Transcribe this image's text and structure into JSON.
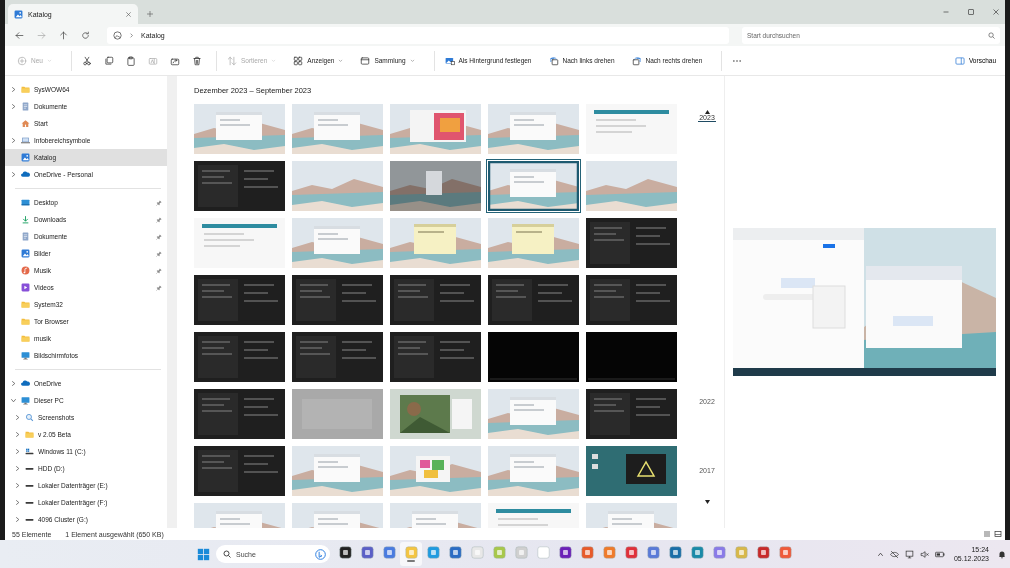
{
  "window": {
    "tab": {
      "title": "Katalog"
    },
    "breadcrumb": [
      {
        "label": "Katalog"
      }
    ],
    "search": {
      "placeholder": "Start durchsuchen"
    }
  },
  "toolbar": [
    {
      "kind": "new",
      "label": "Neu",
      "dropdown": true,
      "disabled": true
    },
    {
      "kind": "separator"
    },
    {
      "kind": "cut",
      "disabled": false
    },
    {
      "kind": "copy",
      "disabled": false
    },
    {
      "kind": "paste",
      "disabled": false
    },
    {
      "kind": "rename",
      "disabled": true
    },
    {
      "kind": "share",
      "disabled": false
    },
    {
      "kind": "delete",
      "disabled": false
    },
    {
      "kind": "separator"
    },
    {
      "kind": "sort",
      "label": "Sortieren",
      "dropdown": true,
      "disabled": true
    },
    {
      "kind": "view",
      "label": "Anzeigen",
      "dropdown": true,
      "disabled": false
    },
    {
      "kind": "collection",
      "label": "Sammlung",
      "dropdown": true,
      "disabled": false
    },
    {
      "kind": "separator"
    },
    {
      "kind": "wallpaper",
      "label": "Als Hintergrund festlegen",
      "dropdown": false,
      "disabled": false
    },
    {
      "kind": "rotate-left",
      "label": "Nach links drehen",
      "dropdown": false,
      "disabled": false
    },
    {
      "kind": "rotate-right",
      "label": "Nach rechts drehen",
      "dropdown": false,
      "disabled": false
    },
    {
      "kind": "separator"
    },
    {
      "kind": "more",
      "disabled": false
    }
  ],
  "preview_button": {
    "label": "Vorschau"
  },
  "sidebar": {
    "sections": [
      [
        {
          "kind": "folder",
          "label": "SysWOW64",
          "expanded": false,
          "selected": false
        },
        {
          "kind": "document",
          "label": "Dokumente",
          "expanded": false,
          "selected": false
        },
        {
          "kind": "home",
          "label": "Start",
          "selected": false
        },
        {
          "kind": "pc",
          "label": "Infobereichsymbole",
          "expanded": false,
          "selected": false
        },
        {
          "kind": "gallery",
          "label": "Katalog",
          "selected": true
        },
        {
          "kind": "cloud",
          "label": "OneDrive - Personal",
          "expanded": false,
          "selected": false
        }
      ],
      [
        {
          "kind": "desktop",
          "label": "Desktop",
          "pinned": true,
          "selected": false
        },
        {
          "kind": "download",
          "label": "Downloads",
          "pinned": true,
          "selected": false
        },
        {
          "kind": "document",
          "label": "Dokumente",
          "pinned": true,
          "selected": false
        },
        {
          "kind": "pictures",
          "label": "Bilder",
          "pinned": true,
          "selected": false
        },
        {
          "kind": "music",
          "label": "Musik",
          "pinned": true,
          "selected": false
        },
        {
          "kind": "video",
          "label": "Videos",
          "pinned": true,
          "selected": false
        },
        {
          "kind": "folder",
          "label": "System32",
          "pinned": false,
          "selected": false
        },
        {
          "kind": "folder",
          "label": "Tor Browser",
          "pinned": false,
          "selected": false
        },
        {
          "kind": "folder",
          "label": "musik",
          "pinned": false,
          "selected": false
        },
        {
          "kind": "monitor",
          "label": "Bildschirmfotos",
          "pinned": false,
          "selected": false
        }
      ],
      [
        {
          "kind": "cloud",
          "label": "OneDrive",
          "expanded": false,
          "selected": false
        },
        {
          "kind": "monitor",
          "label": "Dieser PC",
          "expanded": true,
          "selected": false,
          "children": [
            {
              "kind": "search",
              "label": "Screenshots",
              "expanded": false,
              "selected": false
            },
            {
              "kind": "folder",
              "label": "v 2.05 Beta",
              "expanded": false,
              "selected": false
            },
            {
              "kind": "system-drive",
              "label": "Windows 11 (C:)",
              "expanded": false,
              "selected": false
            },
            {
              "kind": "drive",
              "label": "HDD (D:)",
              "expanded": false,
              "selected": false
            },
            {
              "kind": "drive",
              "label": "Lokaler Datenträger (E:)",
              "expanded": false,
              "selected": false
            },
            {
              "kind": "drive",
              "label": "Lokaler Datenträger (F:)",
              "expanded": false,
              "selected": false
            },
            {
              "kind": "drive",
              "label": "4096 Cluster (G:)",
              "expanded": false,
              "selected": false
            }
          ]
        }
      ]
    ]
  },
  "gallery": {
    "heading": "Dezember 2023 – September 2023",
    "thumbnails": [
      {
        "kind": "picture",
        "selected": false
      },
      {
        "kind": "picture",
        "selected": false
      },
      {
        "kind": "picture",
        "selected": false
      },
      {
        "kind": "picture",
        "selected": false
      },
      {
        "kind": "picture",
        "selected": false
      },
      {
        "kind": "picture",
        "selected": false
      },
      {
        "kind": "picture",
        "selected": false
      },
      {
        "kind": "picture",
        "selected": false
      },
      {
        "kind": "picture",
        "selected": true
      },
      {
        "kind": "picture",
        "selected": false
      },
      {
        "kind": "picture",
        "selected": false
      },
      {
        "kind": "picture",
        "selected": false
      },
      {
        "kind": "picture",
        "selected": false
      },
      {
        "kind": "picture",
        "selected": false
      },
      {
        "kind": "picture",
        "selected": false
      },
      {
        "kind": "picture",
        "selected": false
      },
      {
        "kind": "picture",
        "selected": false
      },
      {
        "kind": "picture",
        "selected": false
      },
      {
        "kind": "picture",
        "selected": false
      },
      {
        "kind": "picture",
        "selected": false
      },
      {
        "kind": "picture",
        "selected": false
      },
      {
        "kind": "picture",
        "selected": false
      },
      {
        "kind": "picture",
        "selected": false
      },
      {
        "kind": "picture",
        "selected": false
      },
      {
        "kind": "picture",
        "selected": false
      },
      {
        "kind": "picture",
        "selected": false
      },
      {
        "kind": "picture",
        "selected": false
      },
      {
        "kind": "picture",
        "selected": false
      },
      {
        "kind": "picture",
        "selected": false
      },
      {
        "kind": "picture",
        "selected": false
      },
      {
        "kind": "picture",
        "selected": false
      },
      {
        "kind": "picture",
        "selected": false
      },
      {
        "kind": "picture",
        "selected": false
      },
      {
        "kind": "picture",
        "selected": false
      },
      {
        "kind": "picture",
        "selected": false
      },
      {
        "kind": "picture",
        "selected": false
      },
      {
        "kind": "picture",
        "selected": false
      },
      {
        "kind": "picture",
        "selected": false
      },
      {
        "kind": "picture",
        "selected": false
      },
      {
        "kind": "picture",
        "selected": false
      }
    ]
  },
  "timeline": {
    "years": [
      {
        "label": "2023",
        "selected": true
      },
      {
        "label": "2022",
        "selected": false
      },
      {
        "label": "2017",
        "selected": false
      }
    ]
  },
  "preview": {
    "kind": "picture"
  },
  "status_bar": {
    "count": "55 Elemente",
    "selection": "1 Element ausgewählt (650 KB)"
  },
  "taskbar": {
    "search": {
      "placeholder": "Suche"
    },
    "apps": [
      {
        "active": false
      },
      {
        "active": false
      },
      {
        "active": false
      },
      {
        "active": true
      },
      {
        "active": false
      },
      {
        "active": false
      },
      {
        "active": false
      },
      {
        "active": false
      },
      {
        "active": false
      },
      {
        "active": false
      },
      {
        "active": false
      },
      {
        "active": false
      },
      {
        "active": false
      },
      {
        "active": false
      },
      {
        "active": false
      },
      {
        "active": false
      },
      {
        "active": false
      },
      {
        "active": false
      },
      {
        "active": false
      },
      {
        "active": false
      },
      {
        "active": false
      }
    ],
    "clock": {
      "time": "15:24",
      "date": "05.12.2023"
    }
  }
}
